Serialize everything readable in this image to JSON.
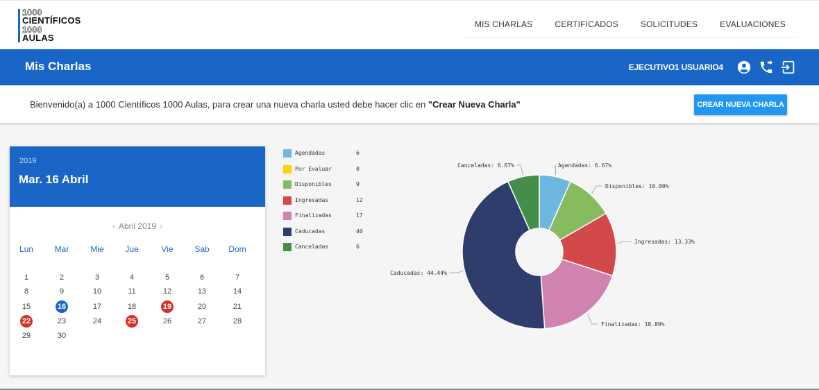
{
  "logo": {
    "line1": "1000",
    "line2": "CIENTÍFICOS",
    "line3": "1000",
    "line4": "AULAS"
  },
  "nav": {
    "items": [
      {
        "label": "MIS CHARLAS"
      },
      {
        "label": "CERTIFICADOS"
      },
      {
        "label": "SOLICITUDES"
      },
      {
        "label": "EVALUACIONES"
      }
    ]
  },
  "header": {
    "title": "Mis Charlas",
    "user_name": "EJECUTIVO1 USUARIO4",
    "icons": [
      "account-circle-icon",
      "phone-forward-icon",
      "logout-icon"
    ]
  },
  "welcome": {
    "text_before": "Bienvenido(a) a 1000 Científicos 1000 Aulas, para crear una nueva charla usted debe hacer clic en ",
    "text_bold": "\"Crear Nueva Charla\"",
    "button_label": "CREAR NUEVA CHARLA"
  },
  "calendar": {
    "year": "2019",
    "date_title": "Mar. 16 Abril",
    "month_label": "Abril 2019",
    "prev_icon": "‹",
    "next_icon": "›",
    "weekdays": [
      "Lun",
      "Mar",
      "Mie",
      "Jue",
      "Vie",
      "Sab",
      "Dom"
    ],
    "weeks": [
      [
        "1",
        "2",
        "3",
        "4",
        "5",
        "6",
        "7"
      ],
      [
        "8",
        "9",
        "10",
        "11",
        "12",
        "13",
        "14"
      ],
      [
        "15",
        "16",
        "17",
        "18",
        "19",
        "20",
        "21"
      ],
      [
        "22",
        "23",
        "24",
        "25",
        "26",
        "27",
        "28"
      ],
      [
        "29",
        "30",
        "",
        "",
        "",
        "",
        ""
      ]
    ],
    "selected_day": "16",
    "highlighted_days": [
      "19",
      "22",
      "25"
    ]
  },
  "chart_data": {
    "type": "pie",
    "donut": true,
    "legend": [
      {
        "name": "Agendadas",
        "value": 6,
        "color": "#6cb8de"
      },
      {
        "name": "Por Evaluar",
        "value": 0,
        "color": "#ffd200"
      },
      {
        "name": "Disponibles",
        "value": 9,
        "color": "#86bb60"
      },
      {
        "name": "Ingresadas",
        "value": 12,
        "color": "#d34848"
      },
      {
        "name": "Finalizadas",
        "value": 17,
        "color": "#d083b1"
      },
      {
        "name": "Caducadas",
        "value": 40,
        "color": "#2e3d6c"
      },
      {
        "name": "Canceladas",
        "value": 6,
        "color": "#438f4a"
      }
    ],
    "slice_labels": [
      "Agendadas: 6.67%",
      "Disponibles: 10.00%",
      "Ingresadas: 13.33%",
      "Finalizadas: 18.89%",
      "Caducadas: 44.44%",
      "Canceladas: 6.67%"
    ]
  }
}
